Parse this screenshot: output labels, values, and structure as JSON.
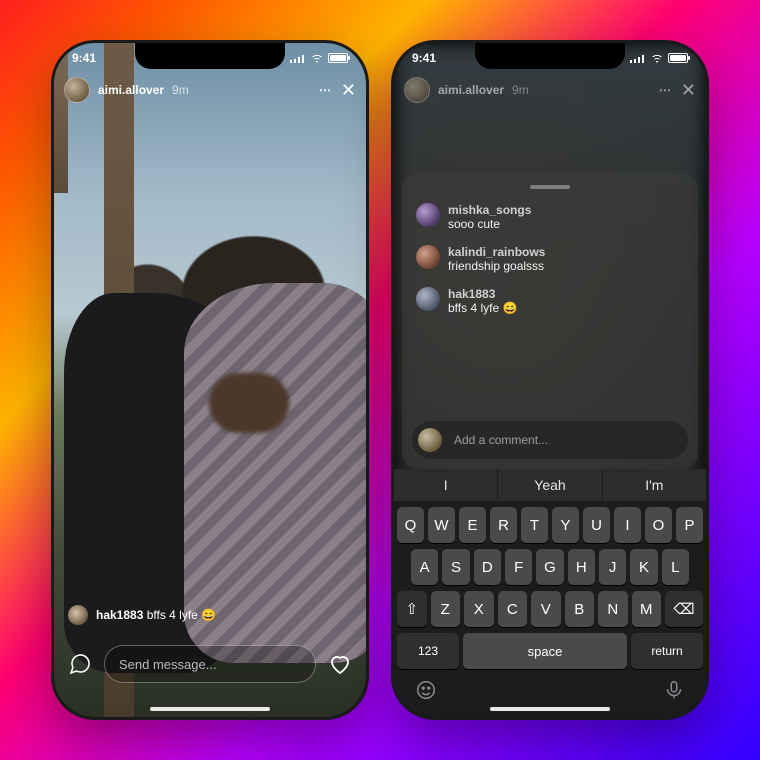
{
  "status": {
    "time": "9:41"
  },
  "story": {
    "username": "aimi.allover",
    "age": "9m",
    "more": "⋯",
    "close": "✕",
    "caption_user": "hak1883",
    "caption_text": "bffs 4 lyfe",
    "caption_emoji": "😄",
    "send_placeholder": "Send message..."
  },
  "comments_panel": {
    "items": [
      {
        "user": "mishka_songs",
        "text": "sooo cute"
      },
      {
        "user": "kalindi_rainbows",
        "text": "friendship goalsss"
      },
      {
        "user": "hak1883",
        "text": "bffs 4 lyfe 😄"
      }
    ],
    "input_placeholder": "Add a comment..."
  },
  "keyboard": {
    "suggestions": [
      "I",
      "Yeah",
      "I'm"
    ],
    "row1": [
      "Q",
      "W",
      "E",
      "R",
      "T",
      "Y",
      "U",
      "I",
      "O",
      "P"
    ],
    "row2": [
      "A",
      "S",
      "D",
      "F",
      "G",
      "H",
      "J",
      "K",
      "L"
    ],
    "row3": [
      "Z",
      "X",
      "C",
      "V",
      "B",
      "N",
      "M"
    ],
    "shift": "⇧",
    "backspace": "⌫",
    "numbers": "123",
    "space": "space",
    "return": "return"
  }
}
